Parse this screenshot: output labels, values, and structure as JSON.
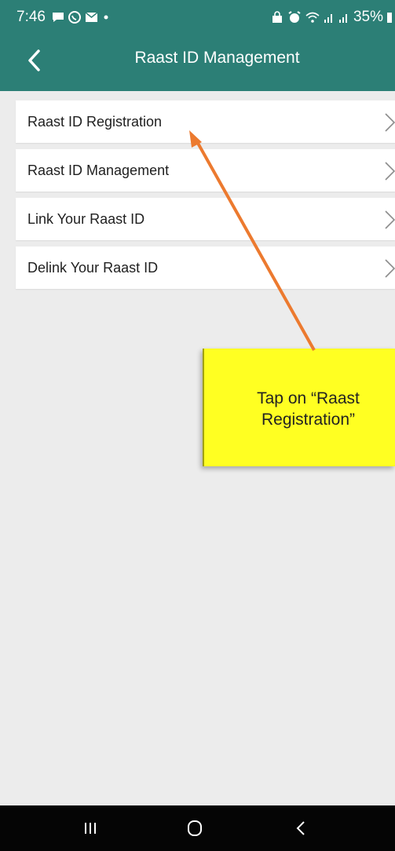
{
  "status_bar": {
    "time": "7:46",
    "battery": "35%"
  },
  "app_bar": {
    "title": "Raast ID Management"
  },
  "menu": {
    "items": [
      {
        "label": "Raast ID Registration"
      },
      {
        "label": "Raast ID Management"
      },
      {
        "label": "Link Your Raast ID"
      },
      {
        "label": "Delink Your Raast ID"
      }
    ]
  },
  "callout": {
    "text": "Tap on “Raast\nRegistration”"
  },
  "colors": {
    "header": "#2c7f76",
    "background": "#ececec",
    "callout_fill": "#ffff22",
    "arrow": "#ec7a2f"
  }
}
